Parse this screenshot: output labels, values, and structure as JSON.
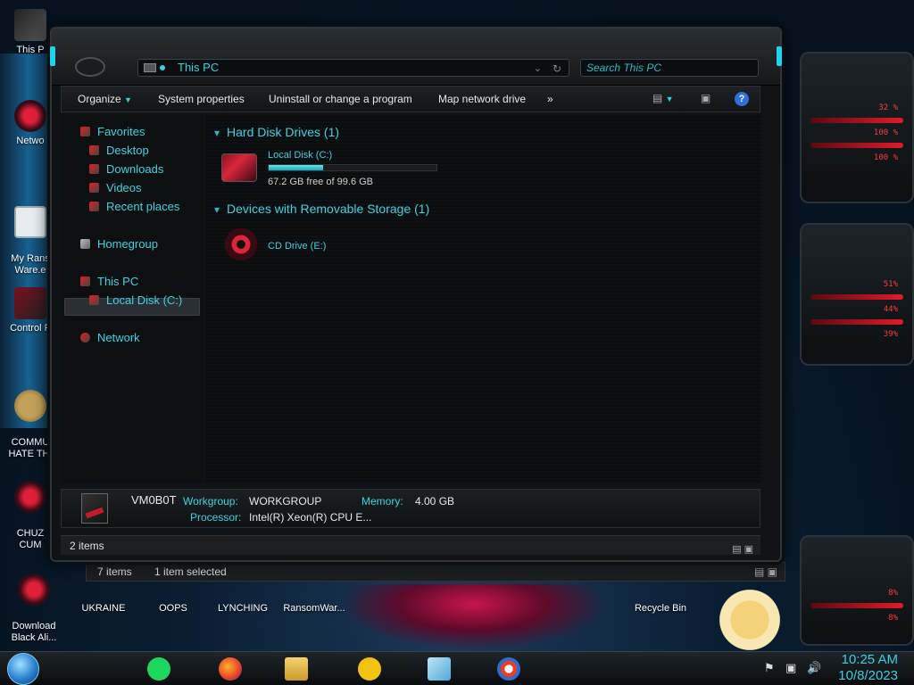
{
  "desktop": {
    "icons_left": [
      {
        "label": "This P"
      },
      {
        "label": "Netwo"
      },
      {
        "label": "My Rans\nWare.e"
      },
      {
        "label": "Control P"
      },
      {
        "label": "COMMU\nHATE THI"
      },
      {
        "label": "CHUZ\nCUM"
      },
      {
        "label": "Download\nBlack Ali..."
      }
    ],
    "icons_bottom": [
      {
        "label": "UKRAINE"
      },
      {
        "label": "OOPS"
      },
      {
        "label": "LYNCHING"
      },
      {
        "label": "RansomWar..."
      },
      {
        "label": "Recycle Bin"
      }
    ],
    "gadget_values": [
      "32 %",
      "100 %",
      "100 %",
      "51%",
      "44%",
      "39%",
      "8%",
      "8%"
    ]
  },
  "window": {
    "address": "This PC",
    "search_placeholder": "Search This PC",
    "toolbar": {
      "organize": "Organize",
      "system_properties": "System properties",
      "uninstall": "Uninstall or change a program",
      "map_drive": "Map network drive",
      "more": "»"
    },
    "nav": {
      "favorites": "Favorites",
      "desktop": "Desktop",
      "downloads": "Downloads",
      "videos": "Videos",
      "recent": "Recent places",
      "homegroup": "Homegroup",
      "this_pc": "This PC",
      "local_disk": "Local Disk (C:)",
      "network": "Network"
    },
    "groups": {
      "hdd_header": "Hard Disk Drives (1)",
      "removable_header": "Devices with Removable Storage (1)"
    },
    "drives": {
      "c_label": "Local Disk (C:)",
      "c_free": "67.2 GB free of 99.6 GB",
      "c_used_fraction": 0.325,
      "e_label": "CD Drive (E:)"
    },
    "details": {
      "computer": "VM0B0T",
      "workgroup_label": "Workgroup:",
      "workgroup": "WORKGROUP",
      "memory_label": "Memory:",
      "memory": "4.00 GB",
      "processor_label": "Processor:",
      "processor": "Intel(R) Xeon(R) CPU E..."
    },
    "status": "2 items"
  },
  "window2_status": {
    "items": "7 items",
    "selected": "1 item selected"
  },
  "taskbar": {
    "time": "10:25 AM",
    "date": "10/8/2023"
  },
  "colors": {
    "accent": "#3fd3e3",
    "window_bg": "#101315",
    "disk_fill": "#1aa8b8"
  }
}
